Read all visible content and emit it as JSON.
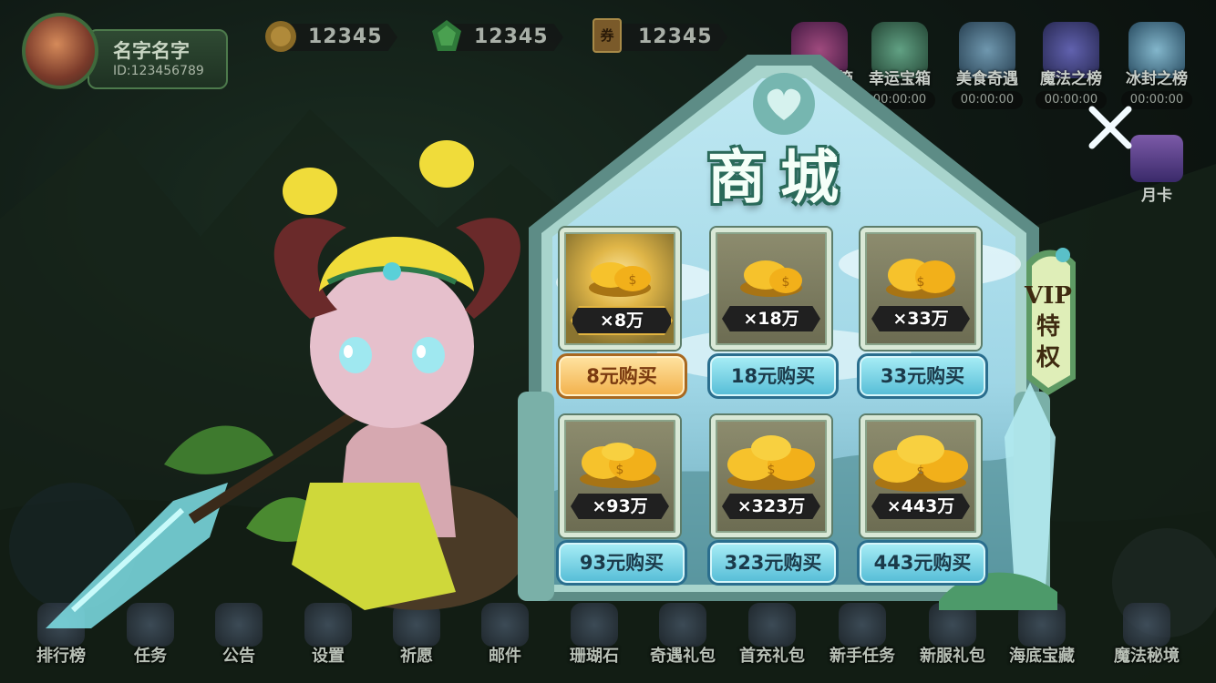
{
  "player": {
    "name": "名字名字",
    "id": "ID:123456789"
  },
  "currencies": [
    {
      "icon": "gold-coin-icon",
      "value": "12345"
    },
    {
      "icon": "green-gem-icon",
      "value": "12345"
    },
    {
      "icon": "coupon-icon",
      "icon_text": "券",
      "value": "12345"
    }
  ],
  "top_events": [
    {
      "label": "宝箱",
      "time": "",
      "icon": "treasure-chest-icon"
    },
    {
      "label": "幸运宝箱",
      "time": "00:00:00",
      "icon": "lucky-chest-icon"
    },
    {
      "label": "美食奇遇",
      "time": "00:00:00",
      "icon": "food-adventure-icon"
    },
    {
      "label": "魔法之榜",
      "time": "00:00:00",
      "icon": "magic-ranking-icon"
    },
    {
      "label": "冰封之榜",
      "time": "00:00:00",
      "icon": "ice-ranking-icon"
    }
  ],
  "month_card": {
    "label": "月卡"
  },
  "shop": {
    "title": "商城",
    "vip_tab": "VIP特权",
    "vip_lines": [
      "VIP",
      "特",
      "权"
    ],
    "items": [
      {
        "amount": "×8万",
        "price": "8元购买",
        "highlight": true
      },
      {
        "amount": "×18万",
        "price": "18元购买",
        "highlight": false
      },
      {
        "amount": "×33万",
        "price": "33元购买",
        "highlight": false
      },
      {
        "amount": "×93万",
        "price": "93元购买",
        "highlight": false
      },
      {
        "amount": "×323万",
        "price": "323元购买",
        "highlight": false
      },
      {
        "amount": "×443万",
        "price": "443元购买",
        "highlight": false
      }
    ]
  },
  "bottom_nav": [
    "排行榜",
    "任务",
    "公告",
    "设置",
    "祈愿",
    "邮件",
    "珊瑚石",
    "奇遇礼包",
    "首充礼包",
    "新手任务",
    "新服礼包",
    "海底宝藏",
    "魔法秘境"
  ],
  "colors": {
    "gold": "#e2b440",
    "teal_button": "#54bcd6",
    "orange_button": "#f2b04a",
    "frame": "#d9e8d6"
  }
}
